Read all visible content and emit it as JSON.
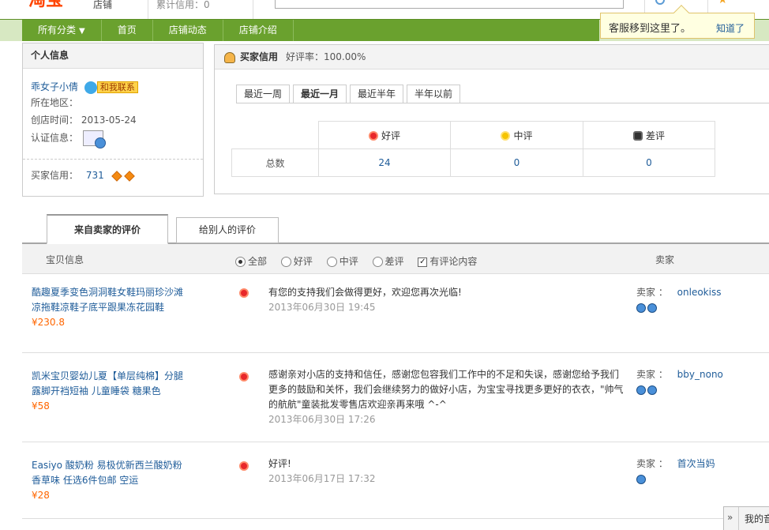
{
  "header": {
    "logo": "淘宝",
    "logo_sub": "店铺",
    "credit": "累计信用：0"
  },
  "nav": {
    "items": [
      "所有分类",
      "首页",
      "店铺动态",
      "店铺介绍"
    ]
  },
  "tooltip": {
    "text": "客服移到这里了。",
    "button": "知道了"
  },
  "info": {
    "title": "个人信息",
    "name": "乖女子小倩",
    "contact": "和我联系",
    "region_label": "所在地区：",
    "created_label": "创店时间：",
    "created_value": "2013-05-24",
    "cert_label": "认证信息：",
    "buyer_credit_label": "买家信用：",
    "buyer_credit_value": "731"
  },
  "credit": {
    "title": "买家信用",
    "rate": "好评率：100.00%",
    "periods": [
      "最近一周",
      "最近一月",
      "最近半年",
      "半年以前"
    ],
    "active_period": 1,
    "columns": [
      "好评",
      "中评",
      "差评"
    ],
    "row_label": "总数",
    "values": [
      "24",
      "0",
      "0"
    ]
  },
  "tabs": {
    "from_seller": "来自卖家的评价",
    "to_others": "给别人的评价"
  },
  "filter": {
    "item_col": "宝贝信息",
    "options": [
      "全部",
      "好评",
      "中评",
      "差评"
    ],
    "has_content": "有评论内容",
    "seller_col": "卖家"
  },
  "reviews": [
    {
      "item": "酷趣夏季变色洞洞鞋女鞋玛丽珍沙滩凉拖鞋凉鞋子底平跟果冻花园鞋",
      "price": "¥230.8",
      "text": "有您的支持我们会做得更好，欢迎您再次光临!",
      "date": "2013年06月30日 19:45",
      "seller_label": "卖家 ：",
      "seller": "onleokiss"
    },
    {
      "item": "凯米宝贝婴幼儿夏【单层纯棉】分腿露脚开裆短袖 儿童睡袋 糖果色",
      "price": "¥58",
      "text": "感谢亲对小店的支持和信任，感谢您包容我们工作中的不足和失误，感谢您给予我们更多的鼓励和关怀，我们会继续努力的做好小店，为宝宝寻找更多更好的衣衣，\"帅气的航航\"童装批发零售店欢迎亲再来哦 ^-^",
      "date": "2013年06月30日 17:26",
      "seller_label": "卖家 ：",
      "seller": "bby_nono"
    },
    {
      "item": "Easiyo 酸奶粉 易极优新西兰酸奶粉 香草味 任选6件包邮 空运",
      "price": "¥28",
      "text": "好评!",
      "date": "2013年06月17日 17:32",
      "seller_label": "卖家 ：",
      "seller": "首次当妈"
    }
  ],
  "widget": {
    "arrow": "»",
    "text": "我的音"
  }
}
